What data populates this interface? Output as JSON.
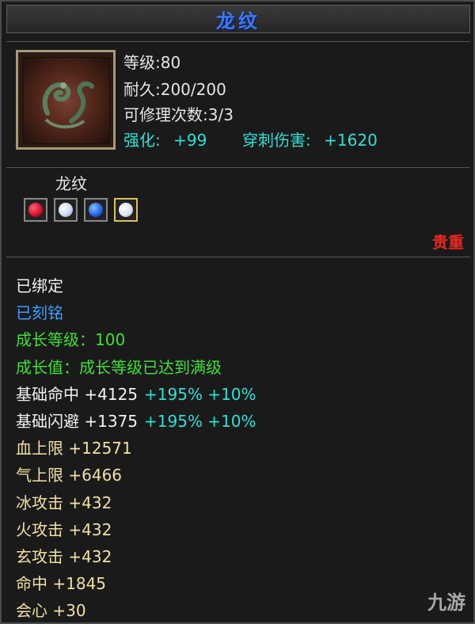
{
  "item": {
    "name": "龙纹",
    "level": "等级:80",
    "durability": "耐久:200/200",
    "repairs": "可修理次数:3/3",
    "enhance_label": "强化:",
    "enhance_value": "+99",
    "pierce_label": "穿刺伤害:",
    "pierce_value": "+1620",
    "gem_set_name": "龙纹",
    "rarity": "贵重"
  },
  "gems": [
    {
      "icon": "red-gem-icon",
      "color": "#d0102a"
    },
    {
      "icon": "white-gem-icon",
      "color": "#c8d4f0"
    },
    {
      "icon": "blue-gem-icon",
      "color": "#2060e0"
    },
    {
      "icon": "white-gem-icon",
      "color": "#d8e0f4"
    }
  ],
  "attributes": [
    {
      "label": "已绑定",
      "color": "#f2f2f2"
    },
    {
      "label": "已刻铭",
      "color": "#3aa0ff"
    },
    {
      "label": "成长等级：100",
      "color": "#3ee03a"
    },
    {
      "label": "成长值：成长等级已达到满级",
      "color": "#3ee03a"
    },
    {
      "label": "基础命中 +4125",
      "extra": "+195% +10%",
      "color": "#f2f2f2",
      "extra_color": "#2fe0d8"
    },
    {
      "label": "基础闪避 +1375",
      "extra": "+195% +10%",
      "color": "#f2f2f2",
      "extra_color": "#2fe0d8"
    },
    {
      "label": "血上限 +12571",
      "color": "#f2e0a0"
    },
    {
      "label": "气上限 +6466",
      "color": "#f2e0a0"
    },
    {
      "label": "冰攻击 +432",
      "color": "#f2e0a0"
    },
    {
      "label": "火攻击 +432",
      "color": "#f2e0a0"
    },
    {
      "label": "玄攻击 +432",
      "color": "#f2e0a0"
    },
    {
      "label": "命中 +1845",
      "color": "#f2e0a0"
    },
    {
      "label": "会心 +30",
      "color": "#f2e0a0"
    }
  ],
  "watermark": "九游"
}
